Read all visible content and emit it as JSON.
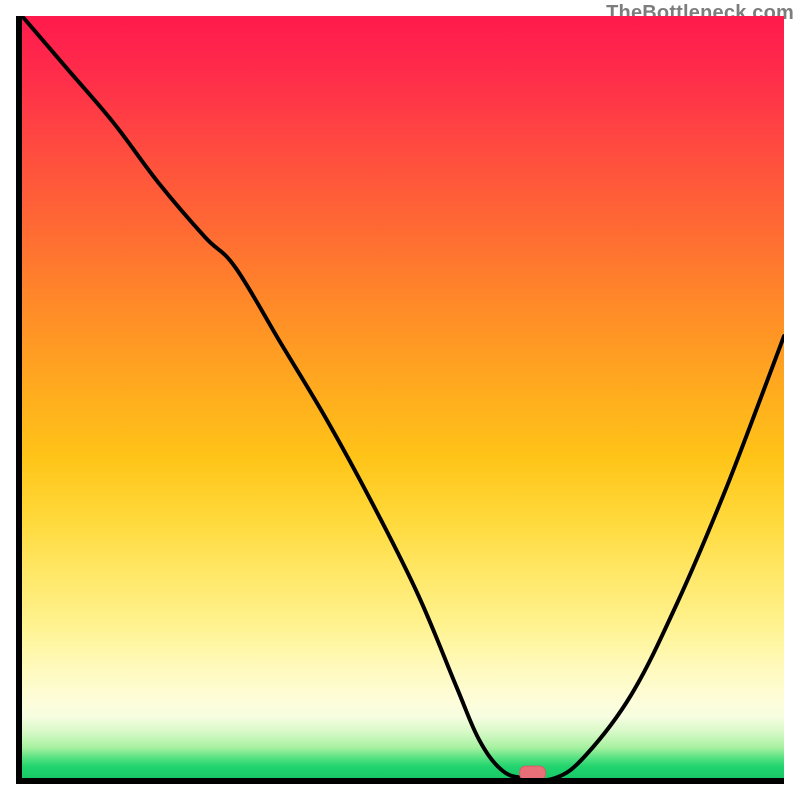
{
  "watermark": "TheBottleneck.com",
  "chart_data": {
    "type": "line",
    "title": "",
    "xlabel": "",
    "ylabel": "",
    "xlim": [
      0,
      100
    ],
    "ylim": [
      0,
      100
    ],
    "grid": false,
    "legend": false,
    "background": "red-yellow-green vertical gradient",
    "series": [
      {
        "name": "bottleneck-curve",
        "x": [
          0,
          6,
          12,
          18,
          24,
          28,
          34,
          40,
          46,
          52,
          57,
          60,
          63,
          66,
          70,
          74,
          80,
          86,
          92,
          97,
          100
        ],
        "y": [
          100,
          93,
          86,
          78,
          71,
          67,
          57,
          47,
          36,
          24,
          12,
          5,
          1,
          0,
          0,
          3,
          11,
          23,
          37,
          50,
          58
        ]
      }
    ],
    "marker": {
      "x": 67,
      "y": 0,
      "color": "#e86f77",
      "shape": "pill"
    }
  }
}
